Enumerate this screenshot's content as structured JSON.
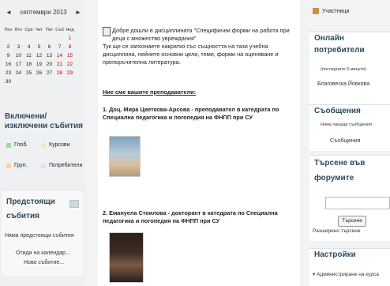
{
  "calendar": {
    "prev": "◄",
    "month": "септември 2013",
    "next": "►",
    "weekdays": [
      "Пон",
      "Вто",
      "Сря",
      "Чет",
      "Пет",
      "Съб",
      "Нед"
    ],
    "weeks": [
      [
        "",
        "",
        "",
        "",
        "",
        "",
        "1"
      ],
      [
        "2",
        "3",
        "4",
        "5",
        "6",
        "7",
        "8"
      ],
      [
        "9",
        "10",
        "11",
        "12",
        "13",
        "14",
        "15"
      ],
      [
        "16",
        "17",
        "18",
        "19",
        "20",
        "21",
        "22"
      ],
      [
        "23",
        "24",
        "25",
        "26",
        "27",
        "28",
        "29"
      ],
      [
        "30",
        "",
        "",
        "",
        "",
        "",
        ""
      ]
    ]
  },
  "events": {
    "title": "Включени/изключени събития",
    "legend": [
      {
        "label": "Глоб.",
        "color": "#9fd89a"
      },
      {
        "label": "Курсови",
        "color": "#ffe5b3"
      },
      {
        "label": "Груп.",
        "color": "#ffd590"
      },
      {
        "label": "Потребители",
        "color": "#d8e6f2"
      }
    ]
  },
  "upcoming": {
    "title": "Предстоящи събития",
    "none": "Няма предстоящи събития",
    "goto": "Отиди на календар...",
    "new": "Ново събитие..."
  },
  "main": {
    "welcome": "Добре дошли в дисциплината \"Специфични форми на работа при деца с множество увреждания\"",
    "intro": "Тук ще се запознаете накратко със същността на тази учебна дисциплина, нейните основни цели, теми, форми на оценяване и препоръчителна литература.",
    "teachers_heading": "Ние сме вашите преподаватели:",
    "teacher1": "1. Доц. Мира Цветкова-Арсова - преподавател в катедрата по Специална педагогика и логопедия на ФНПП при СУ",
    "teacher2": "2. Емануела Стоилова - докторант в катедрата по Специална педагогика и логопедия на ФНПП при СУ"
  },
  "right": {
    "participants": "Участници",
    "online_title": "Онлайн потребители",
    "online_note": "(последните 5 минути)",
    "online_user": "Благовеска Йовкова",
    "messages_title": "Съобщения",
    "messages_none": "Няма чакащи съобщения",
    "messages_link": "Съобщения",
    "search_title": "Търсене във форумите",
    "search_button": "Търсене",
    "advanced_search": "Разширено търсене",
    "settings_title": "Настройки",
    "settings_item": "Администриране на курса"
  },
  "colors": {
    "block_title": "#2e4a5c",
    "weekend": "#cc0000"
  }
}
